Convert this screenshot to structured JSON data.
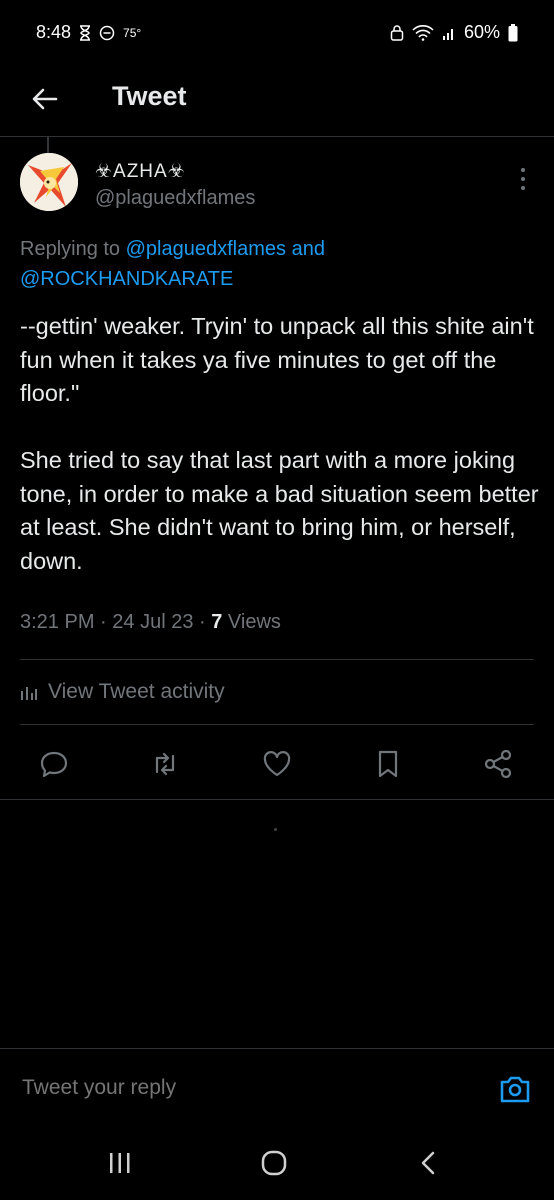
{
  "status_bar": {
    "time": "8:48",
    "temperature": "75°",
    "battery": "60%"
  },
  "header": {
    "title": "Tweet"
  },
  "tweet": {
    "display_name": "☣AZHA☣",
    "handle": "@plaguedxflames",
    "replying_prefix": "Replying to ",
    "reply_to_1": "@plaguedxflames",
    "reply_and": " and",
    "reply_to_2": "@ROCKHANDKARATE",
    "paragraph_1": "--gettin' weaker. Tryin' to unpack all this shite ain't fun when it takes ya five minutes to get off the floor.\"",
    "paragraph_2": "She tried to say that last part with a more joking tone, in order to make a bad situation seem better at least. She didn't want to bring him, or herself, down.",
    "time": "3:21 PM",
    "separator": " · ",
    "date": "24 Jul 23",
    "views_count": "7",
    "views_label": " Views",
    "activity_label": "View Tweet activity"
  },
  "reply_box": {
    "placeholder": "Tweet your reply"
  },
  "icons": {
    "back": "arrow-left-icon",
    "more": "more-vertical-icon",
    "reply": "reply-icon",
    "retweet": "retweet-icon",
    "like": "heart-icon",
    "bookmark": "bookmark-icon",
    "share": "share-icon",
    "camera": "camera-icon"
  },
  "colors": {
    "background": "#000000",
    "text": "#e7e9ea",
    "muted": "#71767b",
    "accent": "#1d9bf0",
    "divider": "#2f3336"
  }
}
